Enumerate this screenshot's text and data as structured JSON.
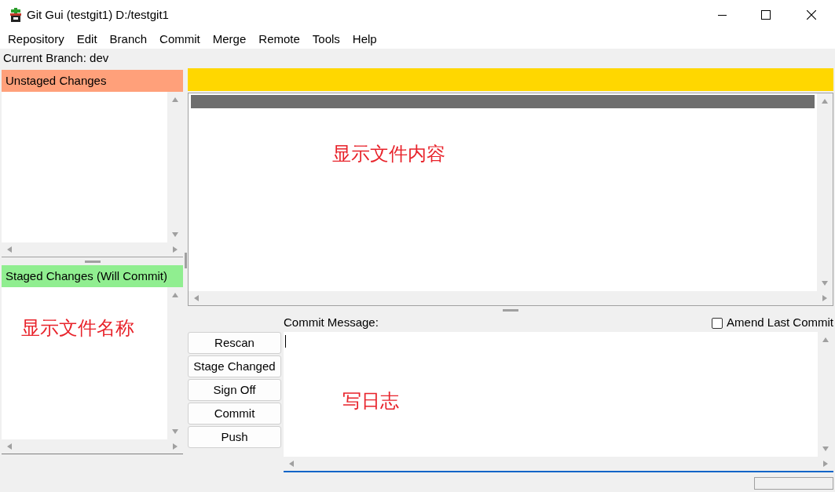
{
  "window": {
    "title": "Git Gui (testgit1) D:/testgit1"
  },
  "menu": [
    "Repository",
    "Edit",
    "Branch",
    "Commit",
    "Merge",
    "Remote",
    "Tools",
    "Help"
  ],
  "current_branch": "Current Branch: dev",
  "unstaged": {
    "header": "Unstaged Changes"
  },
  "staged": {
    "header": "Staged Changes (Will Commit)",
    "annotation": "显示文件名称"
  },
  "diff": {
    "annotation": "显示文件内容"
  },
  "commit": {
    "label": "Commit Message:",
    "amend": {
      "label": "Amend Last Commit",
      "checked": false
    },
    "buttons": [
      "Rescan",
      "Stage Changed",
      "Sign Off",
      "Commit",
      "Push"
    ],
    "annotation": "写日志"
  }
}
